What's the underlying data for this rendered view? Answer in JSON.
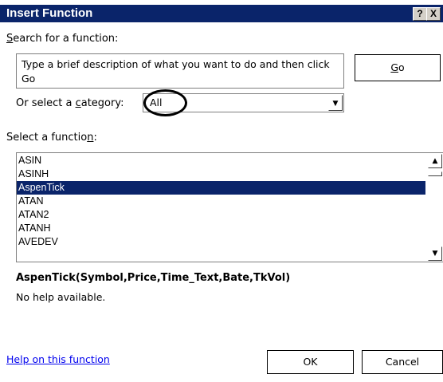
{
  "dialog": {
    "title": "Insert Function",
    "help_button": "?",
    "close_button": "X"
  },
  "search": {
    "label_prefix": "",
    "label_u": "S",
    "label_rest": "earch for a function:",
    "value": "Type a brief description of what you want to do and then click Go",
    "go_u": "G",
    "go_rest": "o"
  },
  "category": {
    "label_a": "Or select a ",
    "label_u": "c",
    "label_b": "ategory:",
    "selected": "All"
  },
  "functions": {
    "label_a": "Select a functio",
    "label_u": "n",
    "label_b": ":",
    "items": [
      "ASIN",
      "ASINH",
      "AspenTick",
      "ATAN",
      "ATAN2",
      "ATANH",
      "AVEDEV"
    ],
    "selected": "AspenTick"
  },
  "details": {
    "signature": "AspenTick(Symbol,Price,Time_Text,Bate,TkVol)",
    "help_text": "No help available."
  },
  "footer": {
    "help_link": "Help on this function",
    "ok_label": "OK",
    "cancel_label": "Cancel"
  },
  "icons": {
    "scroll_up": "scroll-up-arrow-icon",
    "scroll_down": "scroll-down-arrow-icon",
    "dropdown": "dropdown-arrow-icon"
  },
  "colors": {
    "titlebar": "#0a246a",
    "selection": "#0a246a",
    "link": "#0000ee"
  }
}
